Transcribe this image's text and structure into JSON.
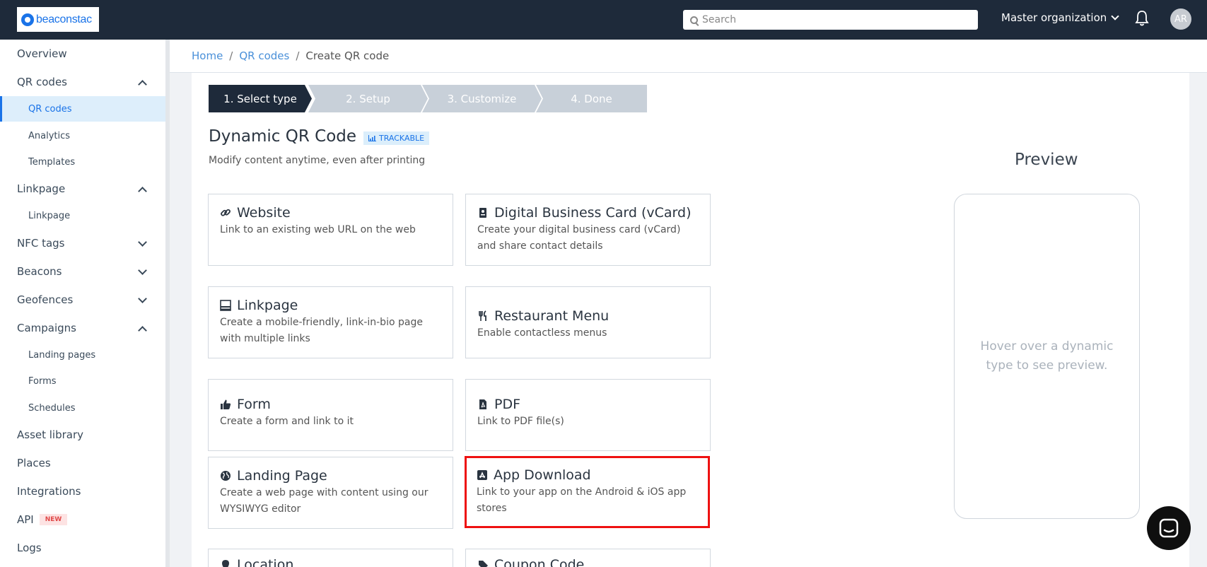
{
  "brand": {
    "logo_text": "beaconstac",
    "accent": "#1a73e8",
    "topbar_color": "#1e2a3a"
  },
  "header": {
    "search_placeholder": "Search",
    "org_label": "Master organization",
    "avatar_initials": "AR"
  },
  "sidebar": {
    "overview": "Overview",
    "qr_codes": "QR codes",
    "qr_codes_sub": "QR codes",
    "analytics": "Analytics",
    "templates": "Templates",
    "linkpage": "Linkpage",
    "linkpage_sub": "Linkpage",
    "nfc_tags": "NFC tags",
    "beacons": "Beacons",
    "geofences": "Geofences",
    "campaigns": "Campaigns",
    "landing_pages": "Landing pages",
    "forms": "Forms",
    "schedules": "Schedules",
    "asset_library": "Asset library",
    "places": "Places",
    "integrations": "Integrations",
    "api": "API",
    "api_badge": "NEW",
    "logs": "Logs"
  },
  "breadcrumb": {
    "home": "Home",
    "qr_codes": "QR codes",
    "current": "Create QR code",
    "sep": "/"
  },
  "steps": [
    "1. Select type",
    "2. Setup",
    "3. Customize",
    "4. Done"
  ],
  "section": {
    "title": "Dynamic QR Code",
    "badge": "TRACKABLE",
    "subtitle": "Modify content anytime, even after printing"
  },
  "cards": {
    "website": {
      "title": "Website",
      "desc": "Link to an existing web URL on the web",
      "icon": "link-icon"
    },
    "vcard": {
      "title": "Digital Business Card (vCard)",
      "desc": "Create your digital business card (vCard) and share contact details",
      "icon": "id-card-icon"
    },
    "linkpage": {
      "title": "Linkpage",
      "desc": "Create a mobile-friendly, link-in-bio page with multiple links",
      "icon": "linkpage-icon"
    },
    "restaurant": {
      "title": "Restaurant Menu",
      "desc": "Enable contactless menus",
      "icon": "cutlery-icon"
    },
    "form": {
      "title": "Form",
      "desc": "Create a form and link to it",
      "icon": "thumbs-up-icon"
    },
    "pdf": {
      "title": "PDF",
      "desc": "Link to PDF file(s)",
      "icon": "pdf-icon"
    },
    "landing": {
      "title": "Landing Page",
      "desc": "Create a web page with content using our WYSIWYG editor",
      "icon": "globe-icon"
    },
    "app": {
      "title": "App Download",
      "desc": "Link to your app on the Android & iOS app stores",
      "icon": "app-store-icon"
    },
    "location": {
      "title": "Location",
      "icon": "map-pin-icon"
    },
    "coupon": {
      "title": "Coupon Code",
      "icon": "tag-icon"
    }
  },
  "preview": {
    "title": "Preview",
    "hint": "Hover over a dynamic type to see preview."
  }
}
